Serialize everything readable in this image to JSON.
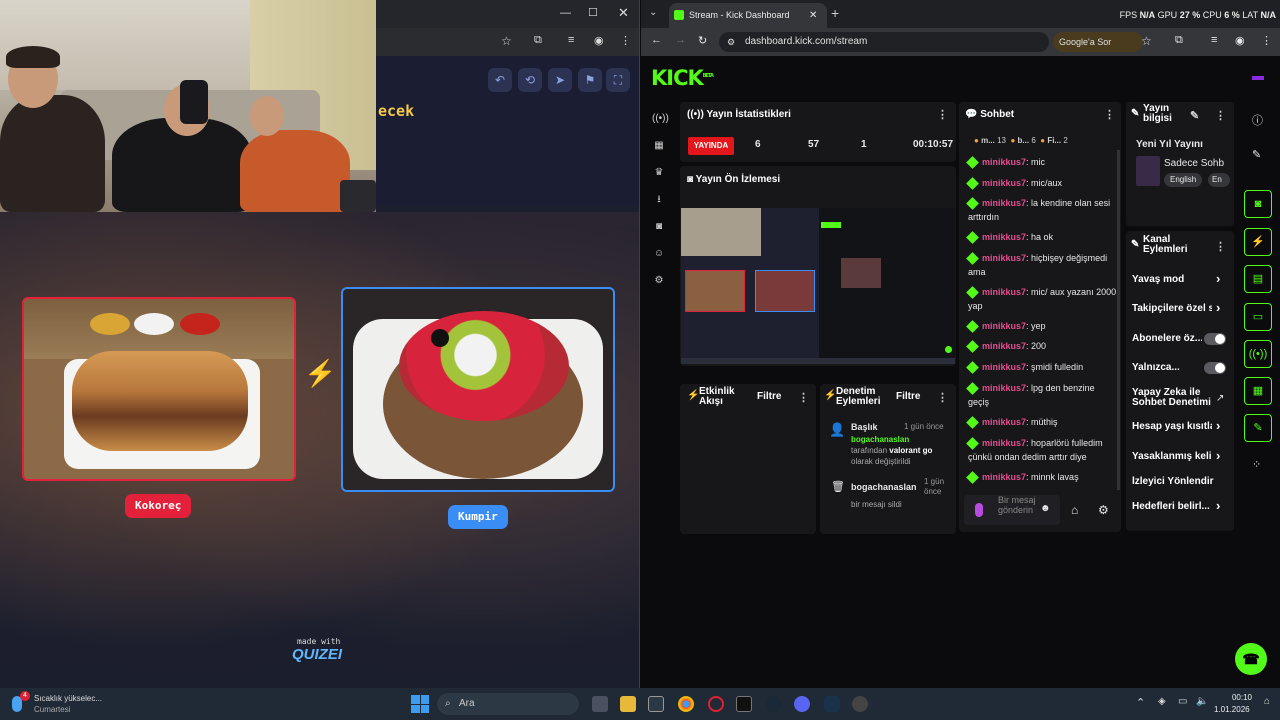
{
  "left": {
    "question_fragment": "ecek",
    "options": [
      {
        "label": "Kokoreç",
        "color": "#e3213b"
      },
      {
        "label": "Kumpir",
        "color": "#3a8df5"
      }
    ],
    "vs_glyph": "⚡",
    "made_with": "made with",
    "brand": "QUIZEI"
  },
  "browser": {
    "tab_title": "Stream - Kick Dashboard",
    "url": "dashboard.kick.com/stream",
    "google_btn": "Google'a Sor",
    "fps_label": "FPS",
    "fps_value": "N/A",
    "gpu_label": "GPU",
    "gpu_value": "27 %",
    "cpu_label": "CPU",
    "cpu_value": "6 %",
    "lat_label": "LAT",
    "lat_value": "N/A"
  },
  "kick": {
    "logo": "KICK",
    "logo_sup": "BETA",
    "stats": {
      "title": "Yayın İstatistikleri",
      "live": "YAYINDA",
      "viewers": "6",
      "followers": "57",
      "subs": "1",
      "time": "00:10:57"
    },
    "preview_title": "Yayın Ön İzlemesi",
    "activity": {
      "title": "Etkinlik Akışı",
      "filter": "Filtre"
    },
    "moderation": {
      "title": "Denetim Eylemleri",
      "filter": "Filtre",
      "item1_title": "Başlık",
      "item1_time": "1 gün önce",
      "item1_user": "bogachanaslan",
      "item1_text1": "tarafından",
      "item1_value": "valorant go",
      "item1_text2": "olarak değiştirildi",
      "item2_user": "bogachanaslan",
      "item2_time": "1 gün önce",
      "item2_text": "bir mesajı sildi"
    },
    "chat": {
      "title": "Sohbet",
      "filters": [
        "m...",
        "13",
        "b...",
        "6",
        "Fi...",
        "2"
      ],
      "messages": [
        {
          "user": "minikkus7",
          "text": "mic"
        },
        {
          "user": "minikkus7",
          "text": "mic/aux"
        },
        {
          "user": "minikkus7",
          "text": "la kendine olan sesi arttırdın"
        },
        {
          "user": "minikkus7",
          "text": "ha ok"
        },
        {
          "user": "minikkus7",
          "text": "hiçbişey değişmedi ama"
        },
        {
          "user": "minikkus7",
          "text": "mic/ aux yazanı 2000 yap"
        },
        {
          "user": "minikkus7",
          "text": "yep"
        },
        {
          "user": "minikkus7",
          "text": "200"
        },
        {
          "user": "minikkus7",
          "text": "şmidi fulledin"
        },
        {
          "user": "minikkus7",
          "text": "lpg den benzine geçiş"
        },
        {
          "user": "minikkus7",
          "text": "müthiş"
        },
        {
          "user": "minikkus7",
          "text": "hoparlörü fulledim çünkü ondan dedim arttır diye"
        },
        {
          "user": "minikkus7",
          "text": "minnk lavaş"
        }
      ],
      "input_placeholder": "Bir mesaj gönderin"
    },
    "stream_info": {
      "title": "Yayın bilgisi",
      "stream_title": "Yeni Yıl Yayını",
      "category": "Sadece Sohb",
      "tags": [
        "English",
        "En"
      ]
    },
    "channel_actions": {
      "title": "Kanal Eylemleri",
      "items": [
        "Yavaş mod",
        "Takipçilere özel s",
        "Abonelere öz...",
        "Yalnızca...",
        "Yapay Zeka ile Sohbet Denetimi",
        "Hesap yaşı kısıtla",
        "Yasaklanmış kelin",
        "İzleyici Yönlendir",
        "Hedefleri belirl..."
      ]
    }
  },
  "taskbar": {
    "weather_line1": "Sıcaklık yükselec...",
    "weather_line2": "Cumartesi",
    "weather_badge": "4",
    "search": "Ara",
    "time": "00:10",
    "date": "1.01.2026"
  }
}
